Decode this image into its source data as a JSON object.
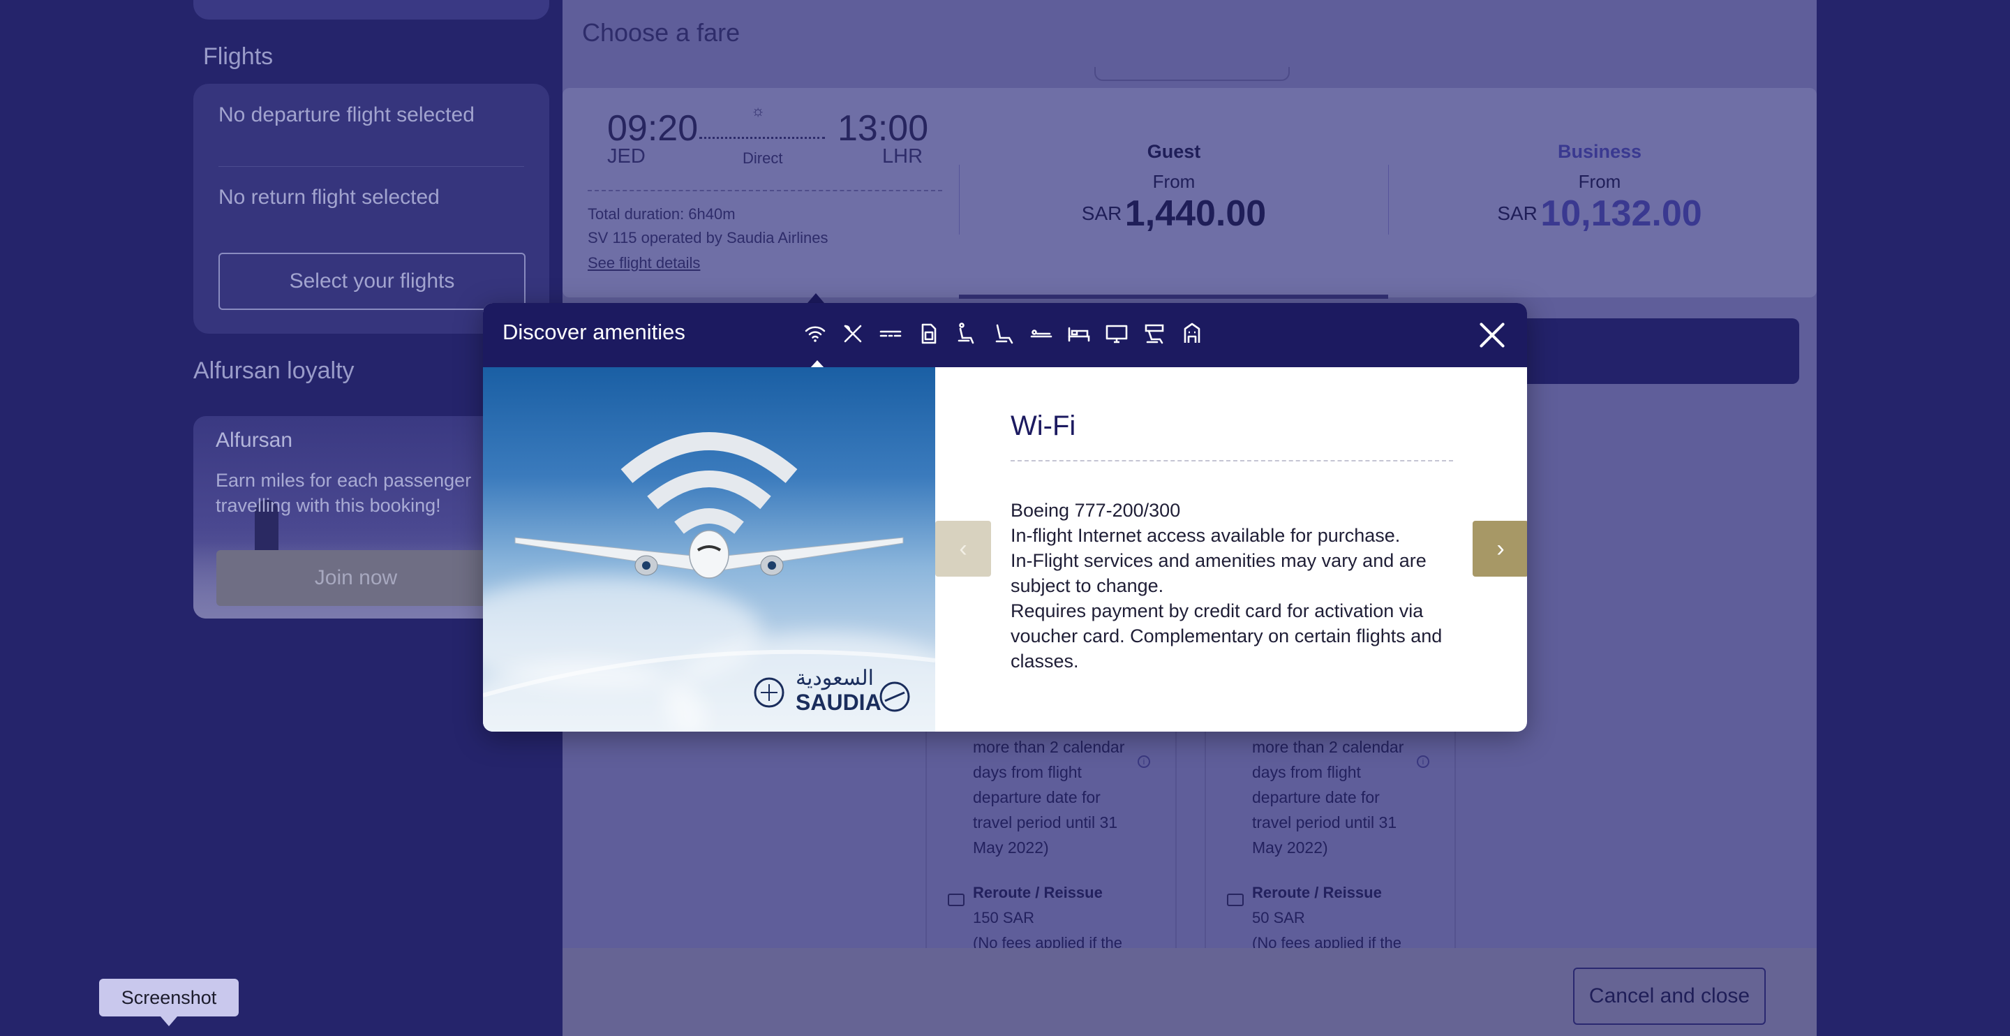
{
  "sidebar": {
    "flights_heading": "Flights",
    "no_departure": "No departure flight selected",
    "no_return": "No return flight selected",
    "select_button": "Select your flights",
    "loyalty_heading": "Alfursan loyalty",
    "alfursan_title": "Alfursan",
    "alfursan_text": "Earn miles for each passenger travelling with this booking!",
    "join_button": "Join now"
  },
  "fare_panel": {
    "title": "Choose a fare",
    "flight": {
      "dep_time": "09:20",
      "dep_code": "JED",
      "arr_time": "13:00",
      "arr_code": "LHR",
      "stops": "Direct",
      "duration": "Total duration: 6h40m",
      "operator": "SV 115 operated by Saudia Airlines",
      "details_link": "See flight details"
    },
    "classes": [
      {
        "name": "Guest",
        "from": "From",
        "currency": "SAR",
        "price": "1,440.00"
      },
      {
        "name": "Business",
        "from": "From",
        "currency": "SAR",
        "price": "10,132.00"
      }
    ],
    "fare_cards": [
      {
        "text": "more than 2 calendar days from flight departure date for travel period until 31 May 2022)",
        "reroute_title": "Reroute / Reissue",
        "reroute_amount": "150 SAR",
        "reroute_note": "(No fees applied if the"
      },
      {
        "text": "more than 2 calendar days from flight departure date for travel period until 31 May 2022)",
        "reroute_title": "Reroute / Reissue",
        "reroute_amount": "50 SAR",
        "reroute_note": "(No fees applied if the"
      }
    ],
    "cancel_button": "Cancel and close"
  },
  "modal": {
    "title": "Discover amenities",
    "icons": [
      "wifi-icon",
      "dining-icon",
      "power-outlet-icon",
      "sim-card-icon",
      "seat-recline-icon",
      "seat-icon",
      "flat-seat-icon",
      "bed-icon",
      "screen-icon",
      "lounge-chair-icon",
      "building-icon"
    ],
    "selected_index": 0,
    "amenity_title": "Wi-Fi",
    "amenity_body": [
      "Boeing 777-200/300",
      "In-flight Internet access available for purchase.",
      "In-Flight services and amenities may vary and are subject to change.",
      "Requires payment by credit card for activation via voucher card. Complementary on certain flights and classes."
    ],
    "logo_english": "SAUDIA",
    "logo_arabic": "السعودية"
  },
  "tooltip": "Screenshot"
}
